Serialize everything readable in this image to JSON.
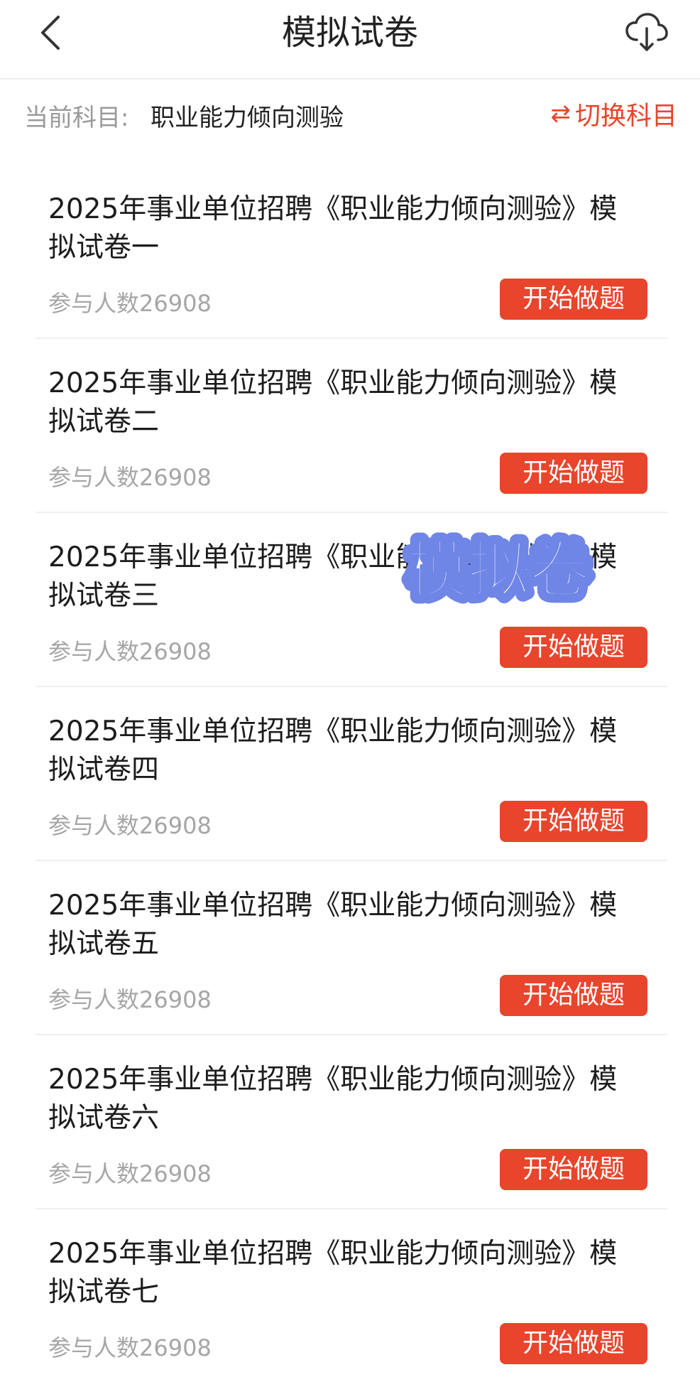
{
  "header": {
    "title": "模拟试卷",
    "back_icon": "chevron-left-icon",
    "download_icon": "cloud-download-icon"
  },
  "subject": {
    "label": "当前科目:",
    "value": "职业能力倾向测验",
    "switch_label": "切换科目",
    "switch_icon": "swap-arrows-icon",
    "accent_color": "#e8452c"
  },
  "papers": [
    {
      "title": "2025年事业单位招聘《职业能力倾向测验》模拟试卷一",
      "participants": "参与人数26908",
      "button": "开始做题"
    },
    {
      "title": "2025年事业单位招聘《职业能力倾向测验》模拟试卷二",
      "participants": "参与人数26908",
      "button": "开始做题"
    },
    {
      "title": "2025年事业单位招聘《职业能力倾向测验》模拟试卷三",
      "participants": "参与人数26908",
      "button": "开始做题"
    },
    {
      "title": "2025年事业单位招聘《职业能力倾向测验》模拟试卷四",
      "participants": "参与人数26908",
      "button": "开始做题"
    },
    {
      "title": "2025年事业单位招聘《职业能力倾向测验》模拟试卷五",
      "participants": "参与人数26908",
      "button": "开始做题"
    },
    {
      "title": "2025年事业单位招聘《职业能力倾向测验》模拟试卷六",
      "participants": "参与人数26908",
      "button": "开始做题"
    },
    {
      "title": "2025年事业单位招聘《职业能力倾向测验》模拟试卷七",
      "participants": "参与人数26908",
      "button": "开始做题"
    }
  ],
  "sticker": {
    "text": "模拟卷",
    "fill_color": "#ffffff",
    "outline_color": "#6f86e6"
  }
}
